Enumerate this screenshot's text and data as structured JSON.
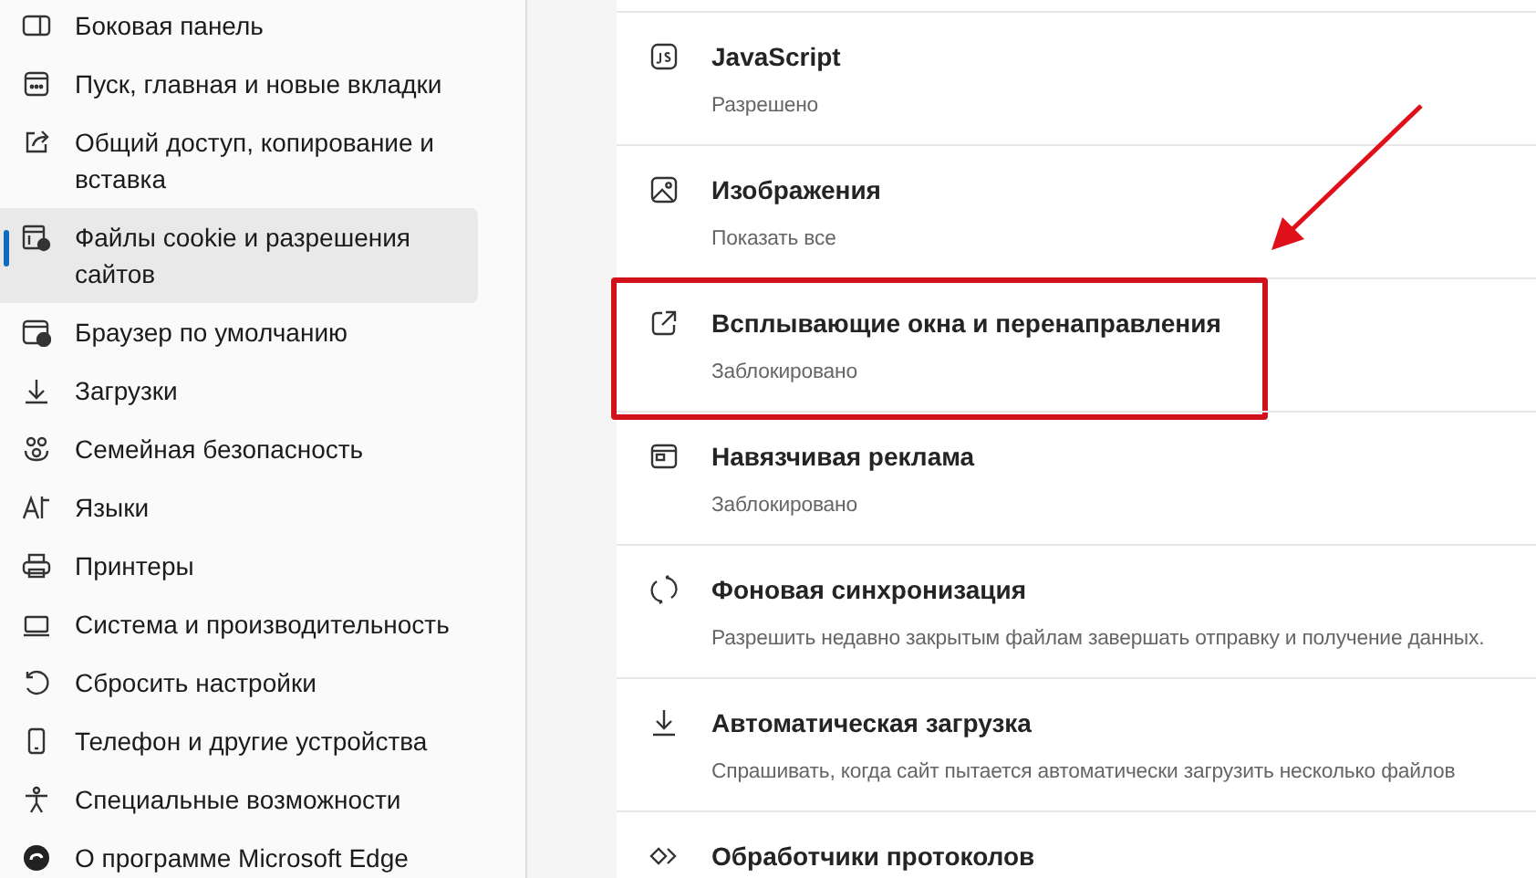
{
  "sidebar": {
    "items": [
      {
        "label": "Боковая панель",
        "selected": false
      },
      {
        "label": "Пуск, главная и новые вкладки",
        "selected": false
      },
      {
        "label": "Общий доступ, копирование и вставка",
        "selected": false
      },
      {
        "label": "Файлы cookie и разрешения сайтов",
        "selected": true
      },
      {
        "label": "Браузер по умолчанию",
        "selected": false
      },
      {
        "label": "Загрузки",
        "selected": false
      },
      {
        "label": "Семейная безопасность",
        "selected": false
      },
      {
        "label": "Языки",
        "selected": false
      },
      {
        "label": "Принтеры",
        "selected": false
      },
      {
        "label": "Система и производительность",
        "selected": false
      },
      {
        "label": "Сбросить настройки",
        "selected": false
      },
      {
        "label": "Телефон и другие устройства",
        "selected": false
      },
      {
        "label": "Специальные возможности",
        "selected": false
      },
      {
        "label": "О программе Microsoft Edge",
        "selected": false
      }
    ]
  },
  "permissions": [
    {
      "title": "JavaScript",
      "status": "Разрешено",
      "highlighted": false
    },
    {
      "title": "Изображения",
      "status": "Показать все",
      "highlighted": false
    },
    {
      "title": "Всплывающие окна и перенаправления",
      "status": "Заблокировано",
      "highlighted": true
    },
    {
      "title": "Навязчивая реклама",
      "status": "Заблокировано",
      "highlighted": false
    },
    {
      "title": "Фоновая синхронизация",
      "status": "Разрешить недавно закрытым файлам завершать отправку и получение данных.",
      "highlighted": false
    },
    {
      "title": "Автоматическая загрузка",
      "status": "Спрашивать, когда сайт пытается автоматически загрузить несколько файлов",
      "highlighted": false
    },
    {
      "title": "Обработчики протоколов",
      "highlighted": false
    }
  ]
}
